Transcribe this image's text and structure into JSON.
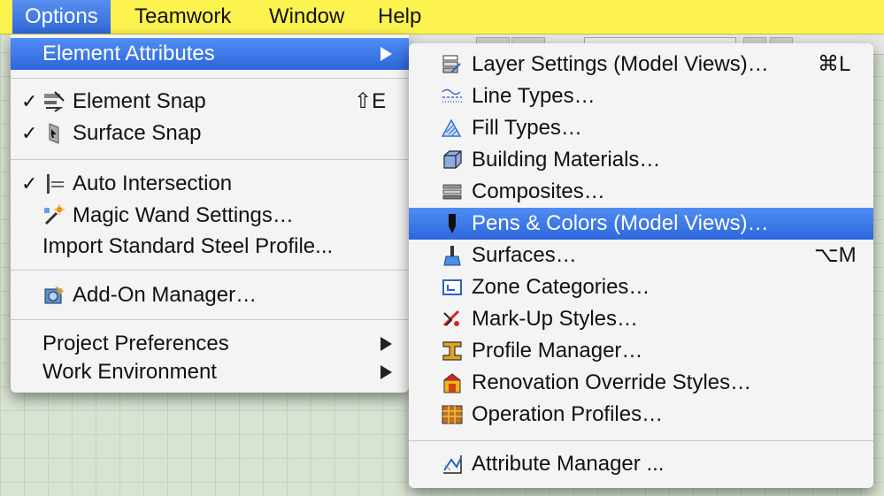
{
  "menubar": {
    "items": [
      "Options",
      "Teamwork",
      "Window",
      "Help"
    ]
  },
  "options_menu": {
    "element_attributes": "Element Attributes",
    "element_snap": {
      "label": "Element Snap",
      "shortcut": "⇧E",
      "check": "✓"
    },
    "surface_snap": {
      "label": "Surface Snap",
      "check": "✓"
    },
    "auto_intersection": {
      "label": "Auto Intersection",
      "check": "✓"
    },
    "magic_wand": "Magic Wand Settings…",
    "import_steel": "Import Standard Steel Profile...",
    "addon_manager": "Add-On Manager…",
    "project_preferences": "Project Preferences",
    "work_environment": "Work Environment"
  },
  "submenu": {
    "layer_settings": {
      "label": "Layer Settings (Model Views)…",
      "shortcut": "⌘L"
    },
    "line_types": "Line Types…",
    "fill_types": "Fill Types…",
    "building_materials": "Building Materials…",
    "composites": "Composites…",
    "pens_colors": "Pens & Colors (Model Views)…",
    "surfaces": {
      "label": "Surfaces…",
      "shortcut": "⌥M"
    },
    "zone_categories": "Zone Categories…",
    "markup_styles": "Mark-Up Styles…",
    "profile_manager": "Profile Manager…",
    "renovation_styles": "Renovation Override Styles…",
    "operation_profiles": "Operation Profiles…",
    "attribute_manager": "Attribute Manager ..."
  },
  "colors": {
    "menubar_bg": "#fdf34f",
    "highlight": "#2e66dd",
    "menu_bg": "#f4f4f4"
  }
}
